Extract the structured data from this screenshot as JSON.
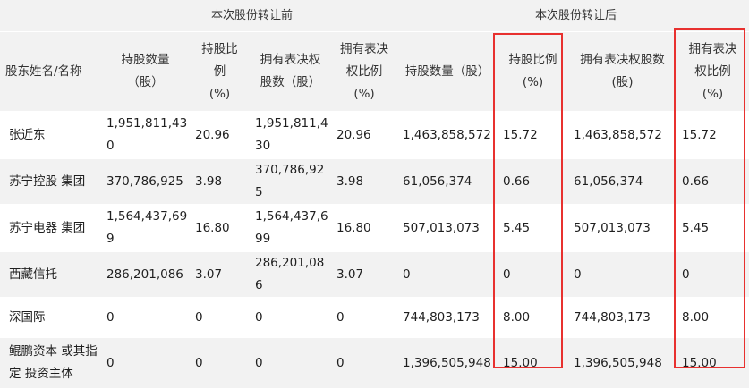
{
  "groups": {
    "before": "本次股份转让前",
    "after": "本次股份转让后"
  },
  "headers": {
    "name": "股东姓名/名称",
    "before_shares": "持股数量\n（股）",
    "before_ratio": "持股比\n例\n(%)",
    "before_vote_shares": "拥有表决权\n股数（股）",
    "before_vote_ratio": "拥有表决\n权比例\n(%)",
    "after_shares": "持股数量（股）",
    "after_ratio": "持股比例\n(%)",
    "after_vote_shares": "拥有表决权股数\n(股)",
    "after_vote_ratio": "拥有表决\n权比例\n(%)"
  },
  "rows": [
    {
      "name": "张近东",
      "before_shares": "1,951,811,430",
      "before_ratio": "20.96",
      "before_vote_shares": "1,951,811,430",
      "before_vote_ratio": "20.96",
      "after_shares": "1,463,858,572",
      "after_ratio": "15.72",
      "after_vote_shares": "1,463,858,572",
      "after_vote_ratio": "15.72"
    },
    {
      "name": "苏宁控股 集团",
      "before_shares": "370,786,925",
      "before_ratio": "3.98",
      "before_vote_shares": "370,786,925",
      "before_vote_ratio": "3.98",
      "after_shares": "61,056,374",
      "after_ratio": "0.66",
      "after_vote_shares": "61,056,374",
      "after_vote_ratio": "0.66"
    },
    {
      "name": "苏宁电器 集团",
      "before_shares": "1,564,437,699",
      "before_ratio": "16.80",
      "before_vote_shares": "1,564,437,699",
      "before_vote_ratio": "16.80",
      "after_shares": "507,013,073",
      "after_ratio": "5.45",
      "after_vote_shares": "507,013,073",
      "after_vote_ratio": "5.45"
    },
    {
      "name": "西藏信托",
      "before_shares": "286,201,086",
      "before_ratio": "3.07",
      "before_vote_shares": "286,201,086",
      "before_vote_ratio": "3.07",
      "after_shares": "0",
      "after_ratio": "0",
      "after_vote_shares": "0",
      "after_vote_ratio": "0"
    },
    {
      "name": "深国际",
      "before_shares": "0",
      "before_ratio": "0",
      "before_vote_shares": "0",
      "before_vote_ratio": "0",
      "after_shares": "744,803,173",
      "after_ratio": "8.00",
      "after_vote_shares": "744,803,173",
      "after_vote_ratio": "8.00"
    },
    {
      "name": "鲲鹏资本 或其指定 投资主体",
      "before_shares": "0",
      "before_ratio": "0",
      "before_vote_shares": "0",
      "before_vote_ratio": "0",
      "after_shares": "1,396,505,948",
      "after_ratio": "15.00",
      "after_vote_shares": "1,396,505,948",
      "after_vote_ratio": "15.00"
    }
  ],
  "colors": {
    "row_alt": "#f2f2f2",
    "highlight": "#e8312f"
  }
}
